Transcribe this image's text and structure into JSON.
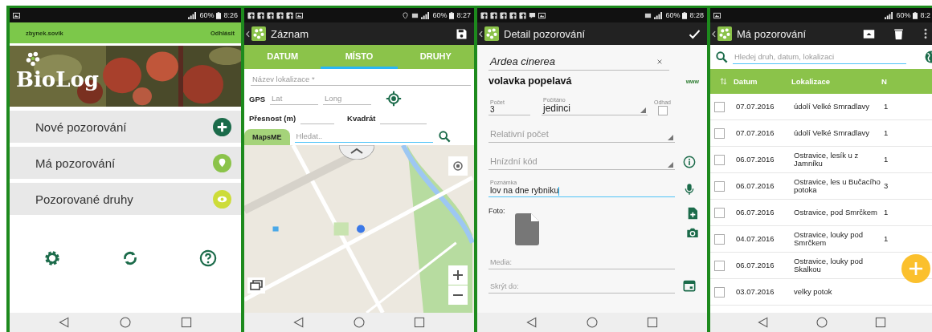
{
  "screens": [
    {
      "kind": "home",
      "status_bar": {
        "battery": "60%",
        "time": "8:26"
      },
      "account": {
        "user": "zbynek.sovik",
        "logout": "Odhlásit"
      },
      "logo": "BioLog",
      "menu": [
        {
          "label": "Nové pozorování",
          "kind": "add",
          "color": "#1b6b4a"
        },
        {
          "label": "Má pozorování",
          "kind": "pin",
          "color": "#8bc34a"
        },
        {
          "label": "Pozorované druhy",
          "kind": "eye",
          "color": "#cddc39"
        }
      ]
    },
    {
      "kind": "record",
      "status_bar": {
        "battery": "60%",
        "time": "8:27"
      },
      "title": "Záznam",
      "tabs": [
        {
          "label": "DATUM",
          "selected": false
        },
        {
          "label": "MÍSTO",
          "selected": true
        },
        {
          "label": "DRUHY",
          "selected": false
        }
      ],
      "location_name": {
        "placeholder": "Název lokalizace *"
      },
      "gps": {
        "label": "GPS",
        "lat": {
          "placeholder": "Lat"
        },
        "long": {
          "placeholder": "Long"
        }
      },
      "accuracy": {
        "label": "Přesnost (m)"
      },
      "quadrant": {
        "label": "Kvadrát"
      },
      "maps_button": "MapsME",
      "search": {
        "placeholder": "Hledat.."
      }
    },
    {
      "kind": "detail",
      "status_bar": {
        "battery": "60%",
        "time": "8:28"
      },
      "title": "Detail pozorování",
      "species": {
        "value": "Ardea cinerea"
      },
      "common_name": "volavka popelavá",
      "link": "www",
      "count": {
        "label": "Počet",
        "value": "3"
      },
      "counted": {
        "label": "Počítáno",
        "value": "jedinci"
      },
      "estimate": {
        "label": "Odhad",
        "checked": false
      },
      "relative_count": {
        "placeholder": "Relativní počet"
      },
      "nesting_code": {
        "placeholder": "Hnízdní kód"
      },
      "note": {
        "label": "Poznámka",
        "value": "lov na dne rybniku"
      },
      "photo_label": "Foto:",
      "media": {
        "placeholder": "Media:"
      },
      "hide_until": {
        "placeholder": "Skrýt do:"
      }
    },
    {
      "kind": "list",
      "status_bar": {
        "battery": "60%",
        "time": "8:2"
      },
      "title": "Má pozorování",
      "search": {
        "placeholder": "Hledej druh, datum, lokalizaci"
      },
      "columns": [
        "Datum",
        "Lokalizace",
        "N"
      ],
      "rows": [
        {
          "checked": false,
          "date": "07.07.2016",
          "place": "údolí Velké Smradlavy",
          "n": "1"
        },
        {
          "checked": false,
          "date": "07.07.2016",
          "place": "údolí Velké Smradlavy",
          "n": "1"
        },
        {
          "checked": false,
          "date": "06.07.2016",
          "place": "Ostravice, lesík u z Jamníku",
          "n": "1"
        },
        {
          "checked": false,
          "date": "06.07.2016",
          "place": "Ostravice, les u Bučacího potoka",
          "n": "3"
        },
        {
          "checked": false,
          "date": "06.07.2016",
          "place": "Ostravice, pod Smrčkem",
          "n": "1"
        },
        {
          "checked": false,
          "date": "04.07.2016",
          "place": "Ostravice, louky pod Smrčkem",
          "n": "1"
        },
        {
          "checked": false,
          "date": "06.07.2016",
          "place": "Ostravice, louky pod Skalkou"
        },
        {
          "checked": false,
          "date": "03.07.2016",
          "place": "velky potok"
        }
      ]
    }
  ]
}
